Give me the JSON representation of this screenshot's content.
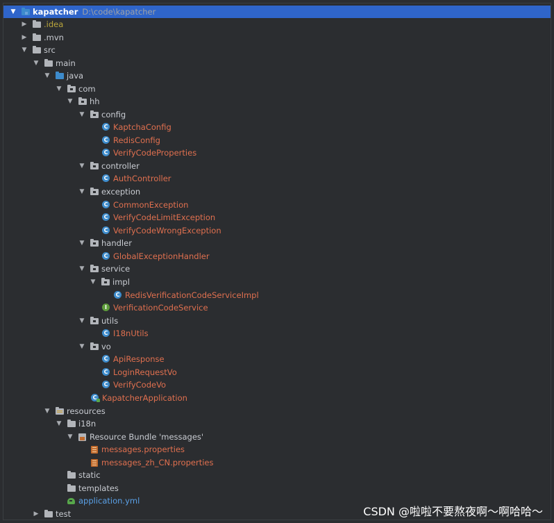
{
  "project": {
    "name": "kapatcher",
    "path": "D:\\code\\kapatcher"
  },
  "tree": {
    "idea": ".idea",
    "mvn": ".mvn",
    "src": "src",
    "main": "main",
    "java": "java",
    "com": "com",
    "hh": "hh",
    "config": "config",
    "kaptcha_config": "KaptchaConfig",
    "redis_config": "RedisConfig",
    "verify_code_properties": "VerifyCodeProperties",
    "controller": "controller",
    "auth_controller": "AuthController",
    "exception": "exception",
    "common_exception": "CommonException",
    "verify_code_limit_exception": "VerifyCodeLimitException",
    "verify_code_wrong_exception": "VerifyCodeWrongException",
    "handler": "handler",
    "global_exception_handler": "GlobalExceptionHandler",
    "service": "service",
    "impl": "impl",
    "redis_verification_code_service_impl": "RedisVerificationCodeServiceImpl",
    "verification_code_service": "VerificationCodeService",
    "utils": "utils",
    "i18n_utils": "I18nUtils",
    "vo": "vo",
    "api_response": "ApiResponse",
    "login_request_vo": "LoginRequestVo",
    "verify_code_vo": "VerifyCodeVo",
    "kapatcher_application": "KapatcherApplication",
    "resources": "resources",
    "i18n": "i18n",
    "resource_bundle": "Resource Bundle 'messages'",
    "messages_properties": "messages.properties",
    "messages_zh_cn_properties": "messages_zh_CN.properties",
    "static": "static",
    "templates": "templates",
    "application_yml": "application.yml",
    "test": "test"
  },
  "icon_letters": {
    "class": "C",
    "exception": "C",
    "interface": "I"
  },
  "watermark": "CSDN @啦啦不要熬夜啊～啊哈哈～",
  "colors": {
    "selection": "#2f65ca",
    "modified_file": "#e0704f",
    "ignored_folder": "#b9a53c",
    "added_file": "#5aa0e6"
  }
}
